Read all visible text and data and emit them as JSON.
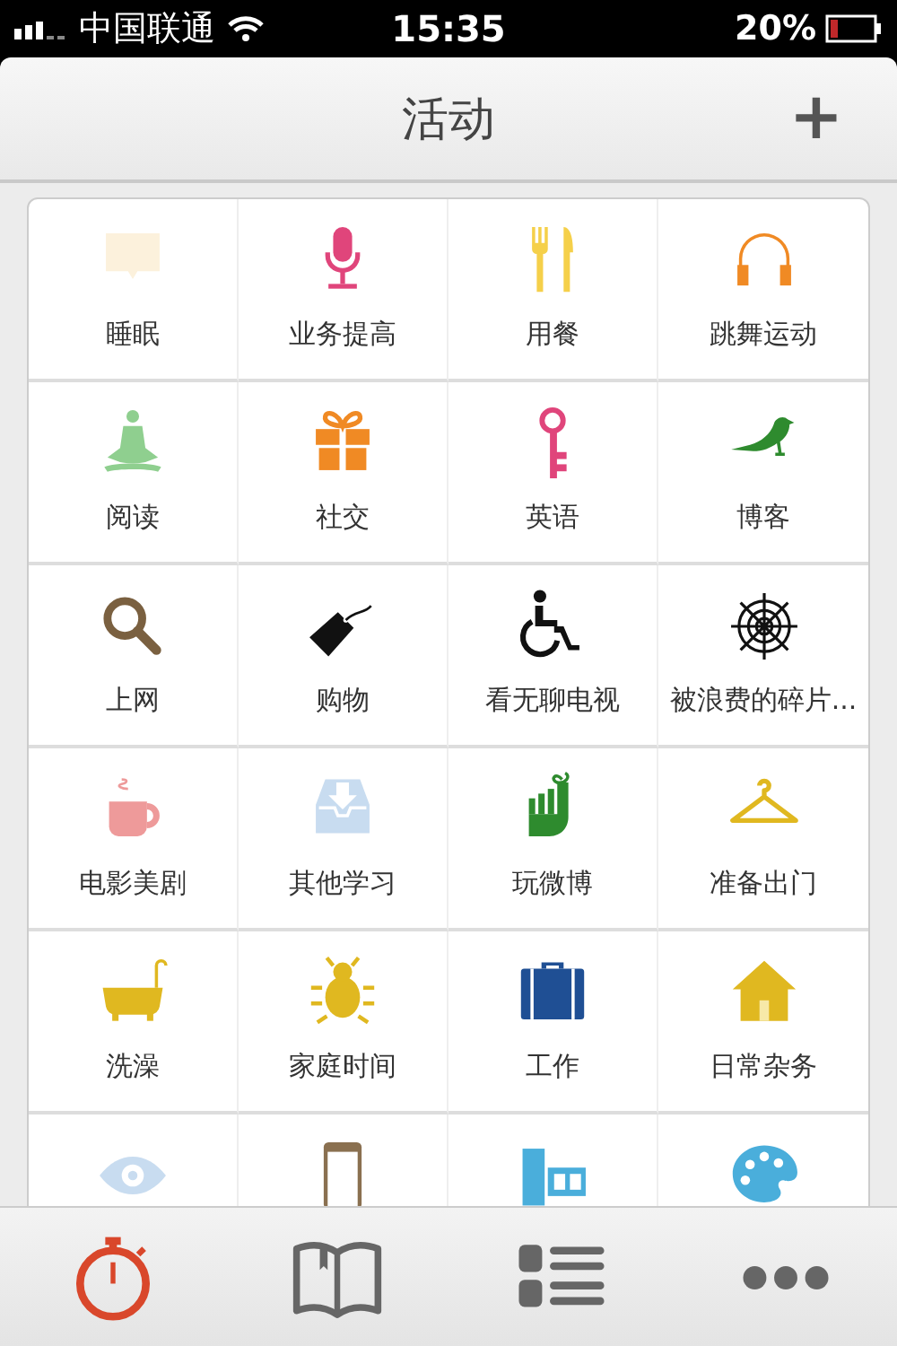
{
  "status_bar": {
    "carrier": "中国联通",
    "time": "15:35",
    "battery": "20%"
  },
  "nav_bar": {
    "title": "活动",
    "add_button": "+"
  },
  "activities": [
    {
      "label": "睡眠",
      "kind": "bubble"
    },
    {
      "label": "业务提高",
      "kind": "microphone"
    },
    {
      "label": "用餐",
      "kind": "cutlery"
    },
    {
      "label": "跳舞运动",
      "kind": "headphones"
    },
    {
      "label": "阅读",
      "kind": "meditation"
    },
    {
      "label": "社交",
      "kind": "gift"
    },
    {
      "label": "英语",
      "kind": "key"
    },
    {
      "label": "博客",
      "kind": "bird"
    },
    {
      "label": "上网",
      "kind": "magnifier"
    },
    {
      "label": "购物",
      "kind": "tag"
    },
    {
      "label": "看无聊电视",
      "kind": "wheelchair"
    },
    {
      "label": "被浪费的碎片...",
      "kind": "web"
    },
    {
      "label": "电影美剧",
      "kind": "cup"
    },
    {
      "label": "其他学习",
      "kind": "inbox"
    },
    {
      "label": "玩微博",
      "kind": "finger"
    },
    {
      "label": "准备出门",
      "kind": "hanger"
    },
    {
      "label": "洗澡",
      "kind": "bathtub"
    },
    {
      "label": "家庭时间",
      "kind": "bug"
    },
    {
      "label": "工作",
      "kind": "briefcase"
    },
    {
      "label": "日常杂务",
      "kind": "house"
    },
    {
      "kind": "eye"
    },
    {
      "kind": "phone"
    },
    {
      "kind": "film"
    },
    {
      "kind": "palette"
    }
  ],
  "tab_bar": [
    {
      "kind": "stopwatch",
      "selected": true
    },
    {
      "kind": "book",
      "selected": false
    },
    {
      "kind": "list",
      "selected": false
    },
    {
      "kind": "more",
      "selected": false
    }
  ]
}
